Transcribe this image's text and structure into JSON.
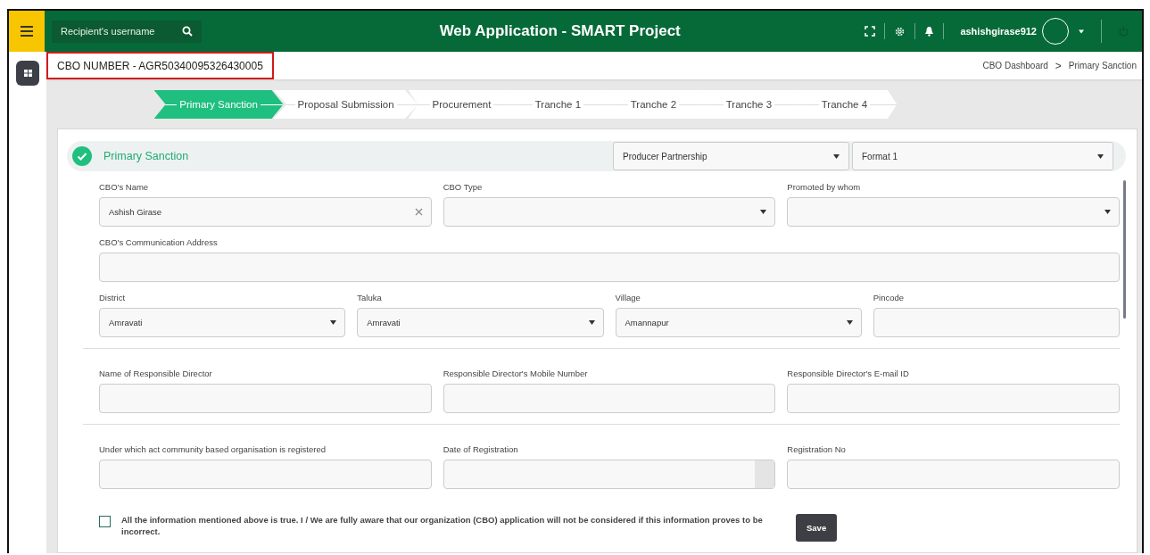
{
  "topbar": {
    "search": {
      "placeholder": "Recipient's username"
    },
    "title": "Web Application - SMART Project",
    "username": "ashishgirase912"
  },
  "cbo_number": "CBO NUMBER - AGR50340095326430005",
  "breadcrumb": [
    "CBO Dashboard",
    "Primary Sanction"
  ],
  "breadcrumb_separator": ">",
  "steps": [
    {
      "label": "Primary Sanction",
      "selected": true
    },
    {
      "label": "Proposal Submission",
      "selected": false
    },
    {
      "label": "Procurement",
      "selected": false
    },
    {
      "label": "Tranche 1",
      "selected": false
    },
    {
      "label": "Tranche 2",
      "selected": false
    },
    {
      "label": "Tranche 3",
      "selected": false
    },
    {
      "label": "Tranche 4",
      "selected": false
    }
  ],
  "section": {
    "title": "Primary Sanction",
    "completed": true,
    "selects": [
      "Producer Partnership",
      "Format 1"
    ]
  },
  "form_sections": [
    {
      "rows": [
        {
          "fields": [
            {
              "label": "CBO's Name",
              "kind": "text",
              "value": "Ashish Girase",
              "clearable": true
            },
            {
              "label": "CBO Type",
              "kind": "select"
            },
            {
              "label": "Promoted by whom",
              "kind": "select"
            }
          ]
        },
        {
          "fields": [
            {
              "label": "CBO's Communication Address",
              "kind": "text"
            }
          ]
        },
        {
          "fields": [
            {
              "label": "District",
              "kind": "select",
              "value": "Amravati"
            },
            {
              "label": "Taluka",
              "kind": "select",
              "value": "Amravati"
            },
            {
              "label": "Village",
              "kind": "select",
              "value": "Amannapur"
            },
            {
              "label": "Pincode",
              "kind": "text"
            }
          ]
        }
      ]
    },
    {
      "rows": [
        {
          "fields": [
            {
              "label": "Name of Responsible Director",
              "kind": "text"
            },
            {
              "label": "Responsible Director's Mobile Number",
              "kind": "text"
            },
            {
              "label": "Responsible Director's E-mail ID",
              "kind": "text"
            }
          ]
        }
      ]
    },
    {
      "rows": [
        {
          "fields": [
            {
              "label": "Under which act community based organisation is registered",
              "kind": "text"
            },
            {
              "label": "Date of Registration",
              "kind": "date"
            },
            {
              "label": "Registration No",
              "kind": "text"
            }
          ]
        }
      ]
    }
  ],
  "declaration": {
    "checked": false,
    "text": "All the information mentioned above is true. I / We are fully aware that our organization (CBO) application will not be considered if this information proves to be incorrect."
  },
  "save_button": "Save"
}
